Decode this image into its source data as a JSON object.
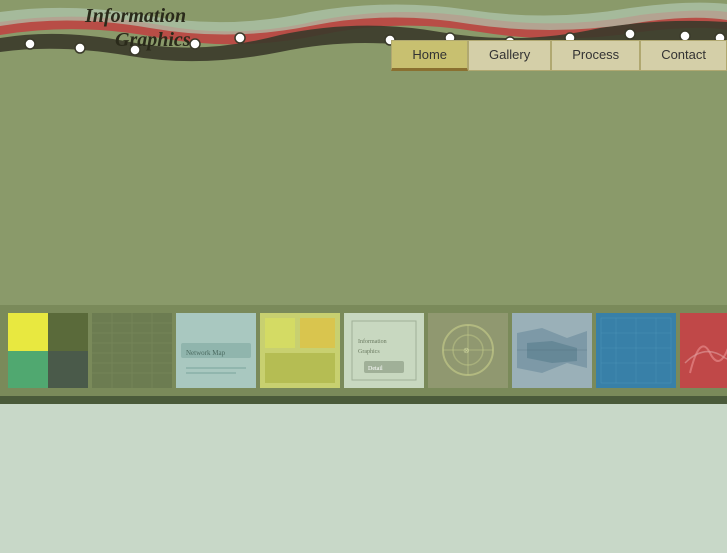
{
  "logo": {
    "line1": "Information",
    "line2": "Graphics"
  },
  "nav": {
    "items": [
      {
        "label": "Home",
        "active": true
      },
      {
        "label": "Gallery",
        "active": false
      },
      {
        "label": "Process",
        "active": false
      },
      {
        "label": "Contact",
        "active": false
      }
    ]
  },
  "gallery": {
    "thumbs": [
      {
        "id": 1,
        "style": "thumb-1"
      },
      {
        "id": 2,
        "style": "thumb-2"
      },
      {
        "id": 3,
        "style": "thumb-3"
      },
      {
        "id": 4,
        "style": "thumb-4"
      },
      {
        "id": 5,
        "style": "thumb-5"
      },
      {
        "id": 6,
        "style": "thumb-6"
      },
      {
        "id": 7,
        "style": "thumb-7"
      },
      {
        "id": 8,
        "style": "thumb-8"
      },
      {
        "id": 9,
        "style": "thumb-9"
      }
    ]
  },
  "colors": {
    "bg_main": "#8a9a6a",
    "bg_footer": "#c8d8c8",
    "accent_dark": "#4a5a3a"
  }
}
